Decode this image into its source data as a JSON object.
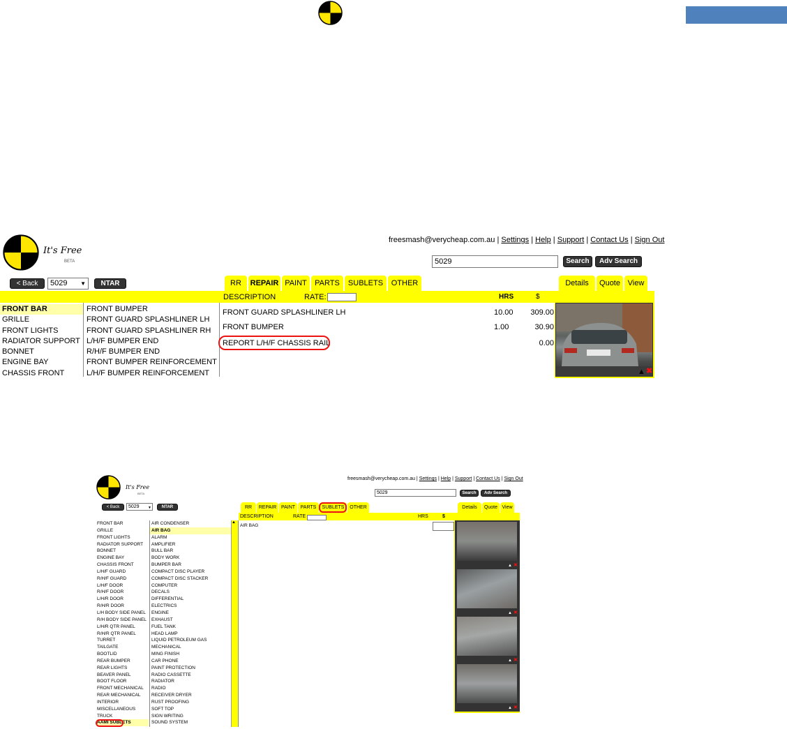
{
  "top_icons": {
    "logo": "crash-test-logo-icon"
  },
  "panel1": {
    "brand": "It's Free",
    "beta": "BETA",
    "user_email": "freesmash@verycheap.com.au",
    "links": [
      "Settings",
      "Help",
      "Support",
      "Contact Us",
      "Sign Out"
    ],
    "search_value": "5029",
    "search_label": "Search",
    "adv_search_label": "Adv Search",
    "back_label": "< Back",
    "job_select": "5029",
    "ntar_label": "NTAR",
    "tabs": [
      "RR",
      "REPAIR",
      "PAINT",
      "PARTS",
      "SUBLETS",
      "OTHER"
    ],
    "right_tabs": [
      "Details",
      "Quote",
      "View"
    ],
    "col_desc": "DESCRIPTION",
    "col_rate": "RATE:",
    "col_hrs": "HRS",
    "col_dollar": "$",
    "sections": [
      "FRONT BAR",
      "GRILLE",
      "FRONT LIGHTS",
      "RADIATOR SUPPORT",
      "BONNET",
      "ENGINE BAY",
      "CHASSIS FRONT"
    ],
    "parts": [
      "FRONT BUMPER",
      "FRONT GUARD SPLASHLINER LH",
      "FRONT GUARD SPLASHLINER RH",
      "L/H/F BUMPER END",
      "R/H/F BUMPER END",
      "FRONT BUMPER REINFORCEMENT",
      "L/H/F BUMPER REINFORCEMENT"
    ],
    "lines": [
      {
        "desc": "FRONT GUARD SPLASHLINER LH",
        "hrs": "10.00",
        "amt": "309.00"
      },
      {
        "desc": "FRONT BUMPER",
        "hrs": "1.00",
        "amt": "30.90"
      },
      {
        "desc": "REPORT L/H/F CHASSIS RAIL",
        "hrs": "",
        "amt": "0.00"
      }
    ]
  },
  "panel2": {
    "brand": "It's Free",
    "beta": "BETA",
    "user_email": "freesmash@verycheap.com.au",
    "links": [
      "Settings",
      "Help",
      "Support",
      "Contact Us",
      "Sign Out"
    ],
    "search_value": "5029",
    "search_label": "Search",
    "adv_search_label": "Adv Search",
    "back_label": "< Back",
    "job_select": "5029",
    "ntar_label": "NTAR",
    "tabs": [
      "RR",
      "REPAIR",
      "PAINT",
      "PARTS",
      "SUBLETS",
      "OTHER"
    ],
    "right_tabs": [
      "Details",
      "Quote",
      "View"
    ],
    "col_desc": "DESCRIPTION",
    "col_rate": "RATE",
    "col_hrs": "HRS",
    "col_dollar": "$",
    "sections": [
      "FRONT BAR",
      "GRILLE",
      "FRONT LIGHTS",
      "RADIATOR SUPPORT",
      "BONNET",
      "ENGINE BAY",
      "CHASSIS FRONT",
      "L/H/F GUARD",
      "R/H/F GUARD",
      "L/H/F DOOR",
      "R/H/F DOOR",
      "L/H/R DOOR",
      "R/H/R DOOR",
      "L/H BODY SIDE PANEL",
      "R/H BODY SIDE PANEL",
      "L/H/R QTR PANEL",
      "R/H/R QTR PANEL",
      "TURRET",
      "TAILGATE",
      "BOOTLID",
      "REAR BUMPER",
      "REAR LIGHTS",
      "BEAVER PANEL",
      "BOOT FLOOR",
      "FRONT MECHANICAL",
      "REAR MECHANICAL",
      "INTERIOR",
      "MISCELLANEOUS",
      "TRUCK",
      "AAMI SUBLETS"
    ],
    "sublets": [
      "AIR CONDENSER",
      "AIR BAG",
      "ALARM",
      "AMPLIFIER",
      "BULL BAR",
      "BODY WORK",
      "BUMPER BAR",
      "COMPACT DISC PLAYER",
      "COMPACT DISC STACKER",
      "COMPUTER",
      "DECALS",
      "DIFFERENTIAL",
      "ELECTRICS",
      "ENGINE",
      "EXHAUST",
      "FUEL TANK",
      "HEAD LAMP",
      "LIQUID PETROLEUM GAS",
      "MECHANICAL",
      "MING FINISH",
      "CAR PHONE",
      "PAINT PROTECTION",
      "RADIO CASSETTE",
      "RADIATOR",
      "RADIO",
      "RECEIVER DRYER",
      "RUST PROOFING",
      "SOFT TOP",
      "SIGN WRITING",
      "SOUND SYSTEM"
    ],
    "lines": [
      {
        "desc": "AIR BAG"
      }
    ]
  }
}
